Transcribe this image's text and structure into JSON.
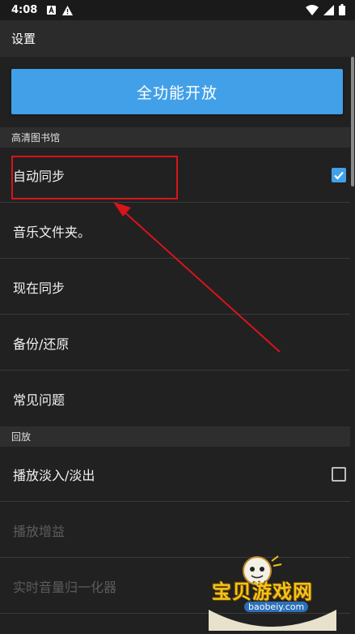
{
  "status_bar": {
    "time": "4:08",
    "left_icons": [
      "a-notification-icon",
      "warning-icon"
    ],
    "right_icons": [
      "wifi-icon",
      "signal-icon",
      "battery-icon"
    ]
  },
  "app_bar": {
    "title": "设置"
  },
  "unlock_button": {
    "label": "全功能开放"
  },
  "sections": [
    {
      "header": "高清图书馆",
      "items": [
        {
          "label": "自动同步",
          "checkbox": "checked",
          "enabled": true
        },
        {
          "label": "音乐文件夹。",
          "enabled": true
        },
        {
          "label": "现在同步",
          "enabled": true
        },
        {
          "label": "备份/还原",
          "enabled": true
        },
        {
          "label": "常见问题",
          "enabled": true
        }
      ]
    },
    {
      "header": "回放",
      "items": [
        {
          "label": "播放淡入/淡出",
          "checkbox": "unchecked",
          "enabled": true
        },
        {
          "label": "播放增益",
          "enabled": false
        },
        {
          "label": "实时音量归一化器",
          "enabled": false
        }
      ]
    }
  ],
  "watermark": {
    "text": "宝贝游戏网",
    "url": "baobeiy.com"
  },
  "colors": {
    "accent": "#42a0e8",
    "background": "#212121",
    "annotation": "#d8141a"
  }
}
